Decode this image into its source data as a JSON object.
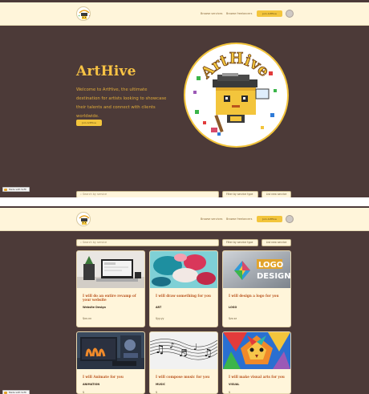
{
  "navbar": {
    "links": [
      "Browse services",
      "Browse freelancers"
    ],
    "cta_label": "Join ArtHive",
    "avatar_icon": "user-avatar-icon"
  },
  "hero": {
    "title": "ArtHive",
    "description": "Welcome to ArtHive, the ultimate destination for artists looking to showcase their talents and connect with clients worldwide.",
    "button_label": "Join ArtHive",
    "logo_text": "ArtHive"
  },
  "filters": {
    "search_placeholder": "Search by service",
    "sort_label": "Filter by service type",
    "clear_label": "List new service"
  },
  "badge": {
    "label": "Made with Softr"
  },
  "services": [
    {
      "title": "I will do an entire revamp of your website",
      "category": "Website Design",
      "price": "$xx.xx",
      "image": "laptop-desk"
    },
    {
      "title": "I will draw something for you",
      "category": "ART",
      "price": "$yy.yy",
      "image": "watercolor"
    },
    {
      "title": "I will design a logo for you",
      "category": "LOGO",
      "price": "$zz.zz",
      "image": "logo-design"
    },
    {
      "title": "I will Animate for you",
      "category": "ANIMATION",
      "price": "$",
      "image": "animation"
    },
    {
      "title": "I will compose music for you",
      "category": "MUSIC",
      "price": "$",
      "image": "music-notes"
    },
    {
      "title": "I will make visual arts for you",
      "category": "VISUAL",
      "price": "$",
      "image": "lion-art"
    }
  ],
  "colors": {
    "background": "#4c3a38",
    "navbar": "#fff5da",
    "accent": "#f3c53c",
    "hero_title": "#f6c244",
    "card_title": "#b9531d"
  }
}
